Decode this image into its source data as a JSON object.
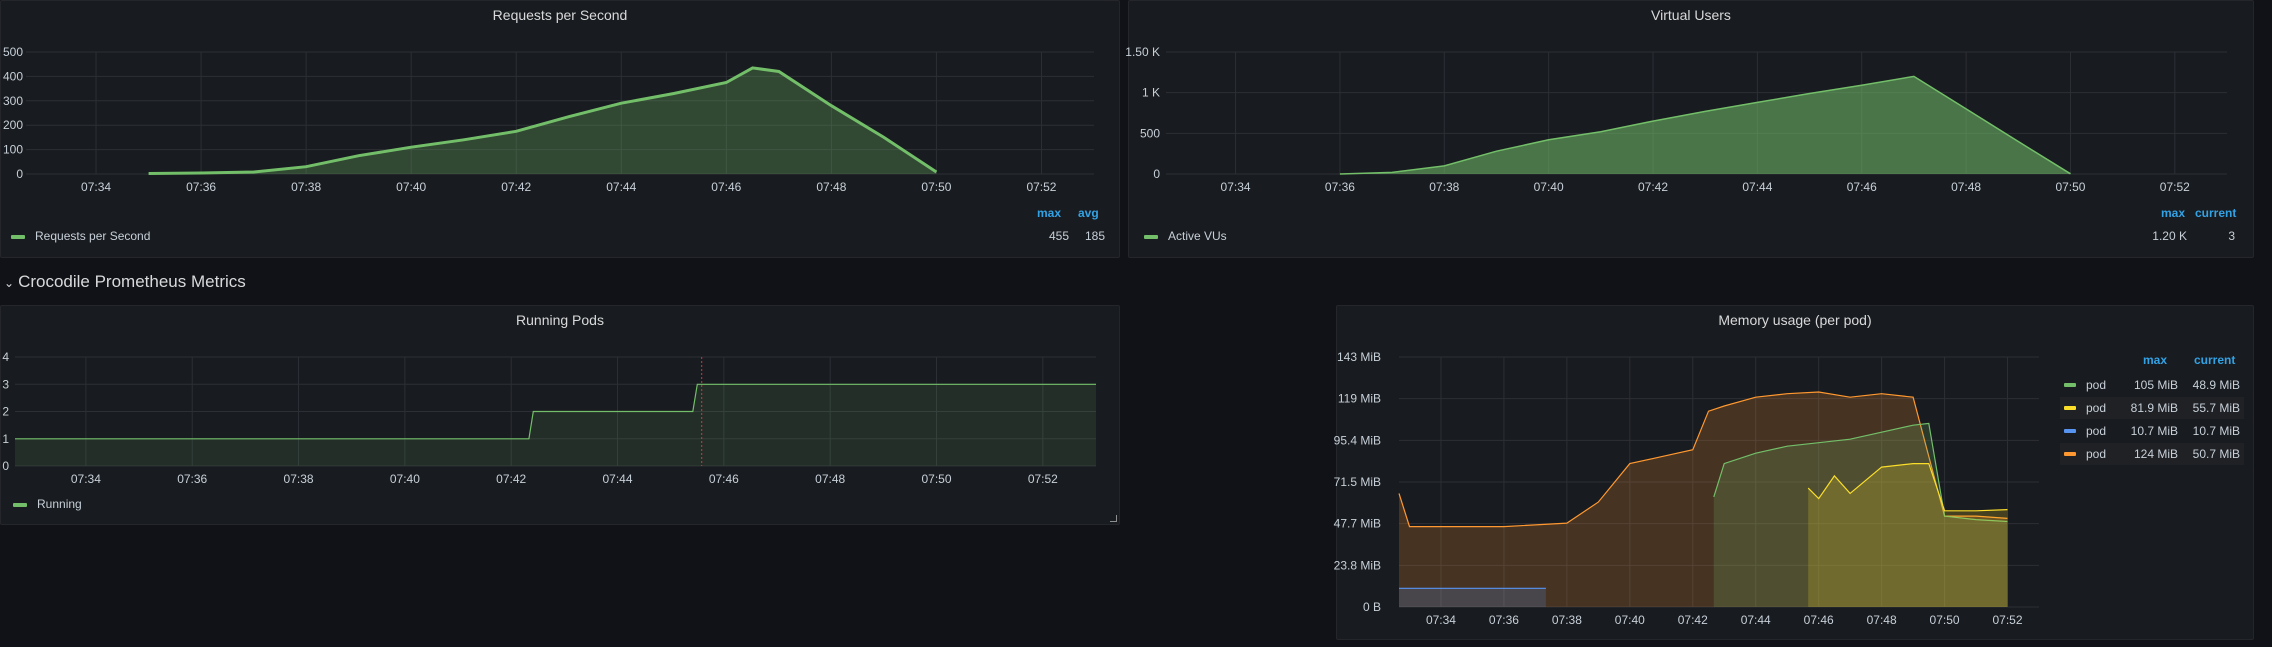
{
  "rps_panel": {
    "title": "Requests per Second",
    "legend": {
      "label": "Requests per Second",
      "max_header": "max",
      "avg_header": "avg",
      "max": "455",
      "avg": "185"
    }
  },
  "vu_panel": {
    "title": "Virtual Users",
    "legend": {
      "label": "Active VUs",
      "max_header": "max",
      "current_header": "current",
      "max": "1.20 K",
      "current": "3"
    }
  },
  "row": {
    "title": "Crocodile Prometheus Metrics",
    "chevron_icon": "chevron-down-icon"
  },
  "pods_panel": {
    "title": "Running Pods",
    "legend": {
      "label": "Running"
    }
  },
  "mem_panel": {
    "title": "Memory usage (per pod)",
    "legend": {
      "max_header": "max",
      "current_header": "current",
      "rows": [
        {
          "name": "pod",
          "max": "105 MiB",
          "current": "48.9 MiB",
          "color": "#73bf69"
        },
        {
          "name": "pod",
          "max": "81.9 MiB",
          "current": "55.7 MiB",
          "color": "#fade2a"
        },
        {
          "name": "pod",
          "max": "10.7 MiB",
          "current": "10.7 MiB",
          "color": "#5794f2"
        },
        {
          "name": "pod",
          "max": "124 MiB",
          "current": "50.7 MiB",
          "color": "#ff9830"
        }
      ]
    }
  },
  "chart_data": [
    {
      "type": "area",
      "title": "Requests per Second",
      "x": [
        "07:35",
        "07:36",
        "07:37",
        "07:38",
        "07:39",
        "07:40",
        "07:41",
        "07:42",
        "07:43",
        "07:44",
        "07:45",
        "07:46",
        "07:46:30",
        "07:47",
        "07:48",
        "07:49",
        "07:50"
      ],
      "x_ticks": [
        "07:34",
        "07:36",
        "07:38",
        "07:40",
        "07:42",
        "07:44",
        "07:46",
        "07:48",
        "07:50",
        "07:52"
      ],
      "y_ticks": [
        "0",
        "100",
        "200",
        "300",
        "400",
        "500"
      ],
      "ylim": [
        0,
        500
      ],
      "series": [
        {
          "name": "Requests per Second",
          "color": "#73bf69",
          "values": [
            2,
            4,
            8,
            30,
            75,
            110,
            140,
            175,
            235,
            290,
            330,
            375,
            435,
            420,
            280,
            150,
            8
          ]
        }
      ]
    },
    {
      "type": "area",
      "title": "Virtual Users",
      "x": [
        "07:36",
        "07:37",
        "07:38",
        "07:39",
        "07:40",
        "07:41",
        "07:42",
        "07:43",
        "07:44",
        "07:45",
        "07:46",
        "07:47",
        "07:48",
        "07:49",
        "07:50"
      ],
      "x_ticks": [
        "07:34",
        "07:36",
        "07:38",
        "07:40",
        "07:42",
        "07:44",
        "07:46",
        "07:48",
        "07:50",
        "07:52"
      ],
      "y_ticks": [
        "0",
        "500",
        "1 K",
        "1.50 K"
      ],
      "ylim": [
        0,
        1500
      ],
      "series": [
        {
          "name": "Active VUs",
          "color": "#73bf69",
          "values": [
            0,
            20,
            100,
            280,
            420,
            520,
            650,
            770,
            880,
            990,
            1090,
            1200,
            800,
            400,
            3
          ]
        }
      ]
    },
    {
      "type": "line",
      "title": "Running Pods",
      "x": [
        "07:32:40",
        "07:32:45",
        "07:42:20",
        "07:42:25",
        "07:45:25",
        "07:45:30",
        "07:53"
      ],
      "x_ticks": [
        "07:34",
        "07:36",
        "07:38",
        "07:40",
        "07:42",
        "07:44",
        "07:46",
        "07:48",
        "07:50",
        "07:52"
      ],
      "y_ticks": [
        "0",
        "1",
        "2",
        "3",
        "4"
      ],
      "ylim": [
        0,
        4
      ],
      "series": [
        {
          "name": "Running",
          "color": "#73bf69",
          "values": [
            1,
            1,
            1,
            2,
            2,
            3,
            3
          ]
        }
      ]
    },
    {
      "type": "area",
      "title": "Memory usage (per pod)",
      "x_ticks": [
        "07:34",
        "07:36",
        "07:38",
        "07:40",
        "07:42",
        "07:44",
        "07:46",
        "07:48",
        "07:50",
        "07:52"
      ],
      "y_ticks": [
        "0 B",
        "23.8 MiB",
        "47.7 MiB",
        "71.5 MiB",
        "95.4 MiB",
        "119 MiB",
        "143 MiB"
      ],
      "ylim": [
        0,
        143
      ],
      "series": [
        {
          "name": "pod",
          "color": "#ff9830",
          "x": [
            "07:32:40",
            "07:33",
            "07:36",
            "07:38",
            "07:39",
            "07:40",
            "07:41",
            "07:42",
            "07:42:30",
            "07:43",
            "07:44",
            "07:45",
            "07:46",
            "07:47",
            "07:48",
            "07:49",
            "07:50",
            "07:51",
            "07:52"
          ],
          "values": [
            65,
            46,
            46,
            48,
            60,
            82,
            86,
            90,
            112,
            115,
            120,
            122,
            123,
            120,
            122,
            120,
            52,
            52,
            50.7
          ]
        },
        {
          "name": "pod",
          "color": "#73bf69",
          "x": [
            "07:42:40",
            "07:43",
            "07:44",
            "07:45",
            "07:46",
            "07:47",
            "07:48",
            "07:49",
            "07:49:30",
            "07:50",
            "07:51",
            "07:52"
          ],
          "values": [
            63,
            82,
            88,
            92,
            94,
            96,
            100,
            104,
            105,
            52,
            50,
            48.9
          ]
        },
        {
          "name": "pod",
          "color": "#fade2a",
          "x": [
            "07:45:40",
            "07:46",
            "07:46:30",
            "07:47",
            "07:48",
            "07:49",
            "07:49:30",
            "07:50",
            "07:51",
            "07:52"
          ],
          "values": [
            68,
            62,
            75,
            65,
            80,
            82,
            82,
            55,
            55,
            55.7
          ]
        },
        {
          "name": "pod",
          "color": "#5794f2",
          "x": [
            "07:32:40",
            "07:37:20"
          ],
          "values": [
            10.7,
            10.7
          ]
        }
      ]
    }
  ]
}
